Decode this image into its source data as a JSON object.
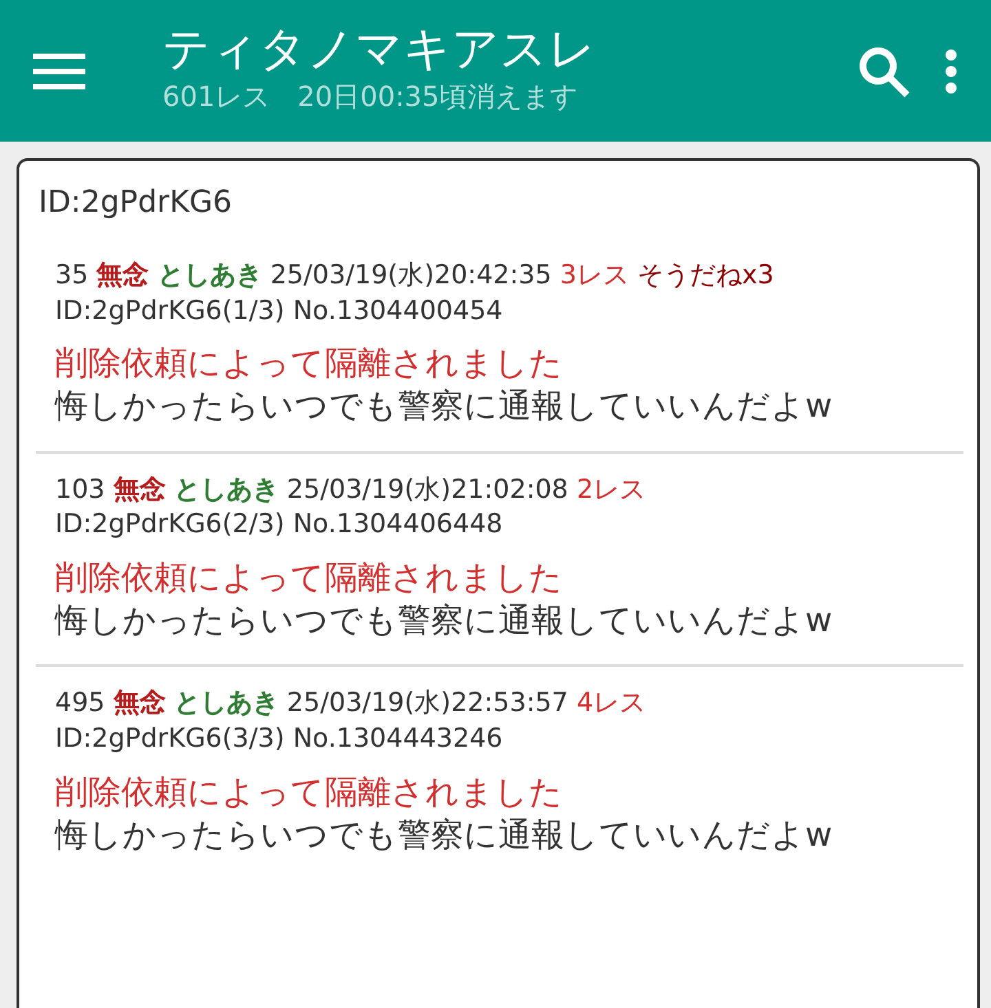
{
  "app_bar": {
    "title": "ティタノマキアスレ",
    "subtitle": "601レス　20日00:35頃消えます"
  },
  "popup": {
    "title": "ID:2gPdrKG6",
    "posts": [
      {
        "number": "35",
        "name": "無念",
        "author": "としあき",
        "date": "25/03/19(水)20:42:35",
        "replies": "3レス",
        "sodane": "そうだねx3",
        "id_line": "ID:2gPdrKG6(1/3) No.1304400454",
        "notice": "削除依頼によって隔離されました",
        "body": "悔しかったらいつでも警察に通報していいんだよw"
      },
      {
        "number": "103",
        "name": "無念",
        "author": "としあき",
        "date": "25/03/19(水)21:02:08",
        "replies": "2レス",
        "id_line": "ID:2gPdrKG6(2/3) No.1304406448",
        "notice": "削除依頼によって隔離されました",
        "body": "悔しかったらいつでも警察に通報していいんだよw"
      },
      {
        "number": "495",
        "name": "無念",
        "author": "としあき",
        "date": "25/03/19(水)22:53:57",
        "replies": "4レス",
        "id_line": "ID:2gPdrKG6(3/3) No.1304443246",
        "notice": "削除依頼によって隔離されました",
        "body": "悔しかったらいつでも警察に通報していいんだよw"
      }
    ]
  }
}
